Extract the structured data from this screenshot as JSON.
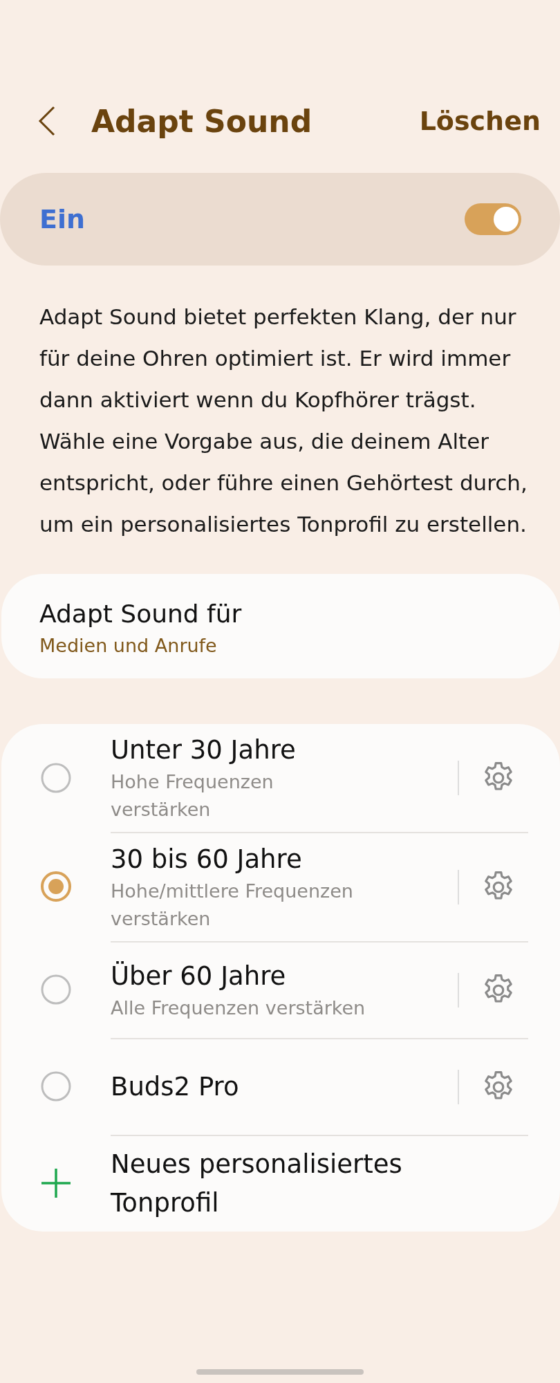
{
  "header": {
    "title": "Adapt Sound",
    "action": "Löschen"
  },
  "master_switch": {
    "label": "Ein",
    "on": true
  },
  "description": "Adapt Sound bietet perfekten Klang, der nur für deine Ohren optimiert ist. Er wird immer dann aktiviert wenn du Kopfhörer trägst. Wähle eine Vorgabe aus, die deinem Alter entspricht, oder führe einen Gehörtest durch, um ein personalisiertes Tonprofil zu erstellen.",
  "target": {
    "title": "Adapt Sound für",
    "value": "Medien und Anrufe"
  },
  "presets": [
    {
      "kind": "radio",
      "title": "Unter 30 Jahre",
      "subtitle": "Hohe Frequenzen verstärken",
      "selected": false
    },
    {
      "kind": "radio",
      "title": "30 bis 60 Jahre",
      "subtitle": "Hohe/mittlere Frequenzen verstärken",
      "selected": true
    },
    {
      "kind": "radio",
      "title": "Über 60 Jahre",
      "subtitle": "Alle Frequenzen verstärken",
      "selected": false
    },
    {
      "kind": "radio",
      "title": "Buds2 Pro",
      "selected": false
    },
    {
      "kind": "add",
      "title": "Neues personalisiertes Tonprofil"
    }
  ]
}
